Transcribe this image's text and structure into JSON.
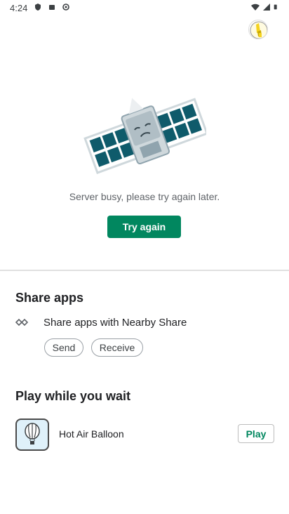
{
  "status_bar": {
    "time": "4:24",
    "left_icons": [
      "shield-icon",
      "play-store-icon",
      "sync-icon"
    ],
    "right_icons": [
      "wifi-icon",
      "signal-icon",
      "battery-icon"
    ]
  },
  "error": {
    "message": "Server busy, please try again later.",
    "retry_label": "Try again"
  },
  "share_apps": {
    "title": "Share apps",
    "row_label": "Share apps with Nearby Share",
    "send_label": "Send",
    "receive_label": "Receive"
  },
  "play_while_wait": {
    "title": "Play while you wait",
    "game_name": "Hot Air Balloon",
    "play_label": "Play"
  },
  "colors": {
    "accent": "#01875f",
    "satellite_panel": "#0f5b6b"
  }
}
